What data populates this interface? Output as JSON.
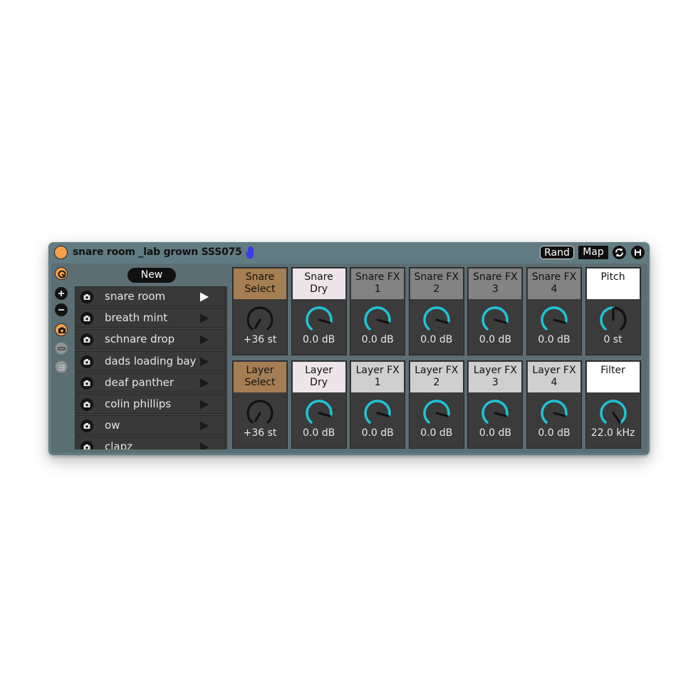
{
  "title": "snare room _lab grown SSS075",
  "header": {
    "rand_label": "Rand",
    "map_label": "Map",
    "sync_icon": "sync-icon",
    "save_icon": "save-icon",
    "hand_icon": "hand-icon"
  },
  "sidebar": {
    "new_label": "New",
    "icons": [
      "power-icon",
      "add-icon",
      "remove-icon",
      "snapshot-icon",
      "minus-bar-icon",
      "list-icon"
    ]
  },
  "presets": [
    {
      "label": "snare room"
    },
    {
      "label": "breath mint"
    },
    {
      "label": "schnare drop"
    },
    {
      "label": "dads loading bay"
    },
    {
      "label": "deaf panther"
    },
    {
      "label": "colin phillips"
    },
    {
      "label": "ow"
    },
    {
      "label": "clapz"
    }
  ],
  "snare_row": [
    {
      "label": "Snare\nSelect",
      "value": "+36 st"
    },
    {
      "label": "Snare\nDry",
      "value": "0.0 dB"
    },
    {
      "label": "Snare FX\n1",
      "value": "0.0 dB"
    },
    {
      "label": "Snare FX\n2",
      "value": "0.0 dB"
    },
    {
      "label": "Snare FX\n3",
      "value": "0.0 dB"
    },
    {
      "label": "Snare FX\n4",
      "value": "0.0 dB"
    },
    {
      "label": "Pitch",
      "value": "0 st"
    }
  ],
  "layer_row": [
    {
      "label": "Layer\nSelect",
      "value": "+36 st"
    },
    {
      "label": "Layer\nDry",
      "value": "0.0 dB"
    },
    {
      "label": "Layer FX\n1",
      "value": "0.0 dB"
    },
    {
      "label": "Layer FX\n2",
      "value": "0.0 dB"
    },
    {
      "label": "Layer FX\n3",
      "value": "0.0 dB"
    },
    {
      "label": "Layer FX\n4",
      "value": "0.0 dB"
    },
    {
      "label": "Filter",
      "value": "22.0 kHz"
    }
  ],
  "colors": {
    "accent_cyan": "#1fc3d6",
    "accent_orange": "#f5a04a",
    "select_brown": "#a67e53",
    "panel_blue_gray": "#617b82",
    "hand_blue": "#3b3be6"
  }
}
